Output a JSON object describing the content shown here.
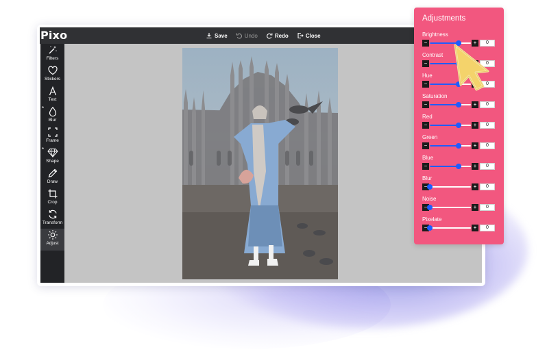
{
  "app": {
    "logo": "Pixo"
  },
  "toolbar": {
    "save": "Save",
    "undo": "Undo",
    "redo": "Redo",
    "close": "Close"
  },
  "sidebar": {
    "items": [
      {
        "label": "Filters",
        "icon": "magic-wand-icon",
        "starred": false,
        "active": false
      },
      {
        "label": "Stickers",
        "icon": "heart-icon",
        "starred": false,
        "active": false
      },
      {
        "label": "Text",
        "icon": "text-icon",
        "starred": false,
        "active": false
      },
      {
        "label": "Blur",
        "icon": "droplet-icon",
        "starred": true,
        "active": false
      },
      {
        "label": "Frame",
        "icon": "frame-icon",
        "starred": false,
        "active": false
      },
      {
        "label": "Shape",
        "icon": "diamond-icon",
        "starred": true,
        "active": false
      },
      {
        "label": "Draw",
        "icon": "pencil-icon",
        "starred": false,
        "active": false
      },
      {
        "label": "Crop",
        "icon": "crop-icon",
        "starred": false,
        "active": false
      },
      {
        "label": "Transform",
        "icon": "rotate-icon",
        "starred": false,
        "active": false
      },
      {
        "label": "Adjust",
        "icon": "sun-icon",
        "starred": false,
        "active": true
      }
    ],
    "star_glyph": "*"
  },
  "panel": {
    "title": "Adjustments",
    "minus_glyph": "−",
    "plus_glyph": "+",
    "adjustments": [
      {
        "label": "Brightness",
        "value": "0",
        "level": 0.7
      },
      {
        "label": "Contrast",
        "value": "0",
        "level": 0.7
      },
      {
        "label": "Hue",
        "value": "0",
        "level": 0.7
      },
      {
        "label": "Saturation",
        "value": "0",
        "level": 0.7
      },
      {
        "label": "Red",
        "value": "0",
        "level": 0.7
      },
      {
        "label": "Green",
        "value": "0",
        "level": 0.7
      },
      {
        "label": "Blue",
        "value": "0",
        "level": 0.7
      },
      {
        "label": "Blur",
        "value": "0",
        "level": 0.0
      },
      {
        "label": "Noise",
        "value": "0",
        "level": 0.0
      },
      {
        "label": "Pixelate",
        "value": "0",
        "level": 0.0
      }
    ]
  },
  "colors": {
    "panel": "#f2577f",
    "slider": "#1e5cff",
    "toolbar": "#303134",
    "sidebar": "#222326",
    "canvas": "#c4c4c4",
    "cursor": "#f4d36b"
  },
  "cursor_icon": "pointer-cursor-icon"
}
